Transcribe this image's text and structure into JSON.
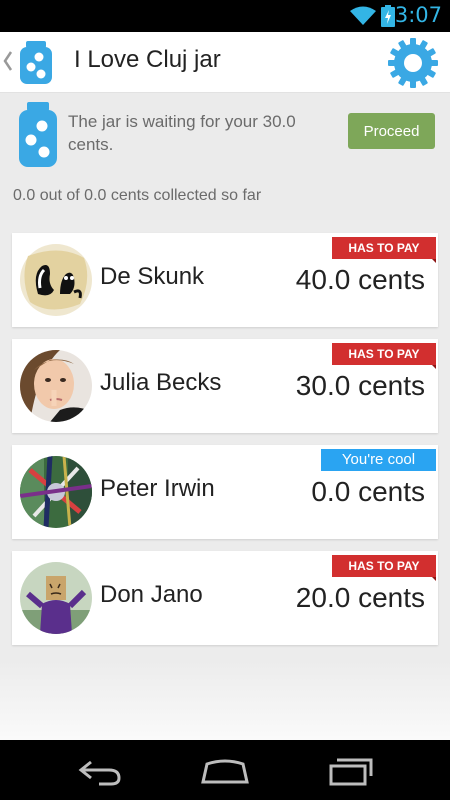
{
  "status_bar": {
    "time": "3:07",
    "wifi_icon": "wifi-icon",
    "battery_icon": "battery-charging-icon",
    "accent": "#33b5e5"
  },
  "action_bar": {
    "title": "I Love Cluj jar",
    "app_icon": "jar-icon",
    "up_icon": "chevron-left-icon",
    "settings_icon": "gear-icon",
    "accent": "#3aa8e4"
  },
  "summary": {
    "message": "The jar is waiting for your 30.0 cents.",
    "proceed_label": "Proceed",
    "collected": "0.0 out of 0.0 cents collected so far",
    "proceed_color": "#7ea759"
  },
  "members": [
    {
      "name": "De Skunk",
      "amount": "40.0 cents",
      "badge": "HAS TO PAY",
      "badge_type": "pay",
      "avatar": "skunk-avatar"
    },
    {
      "name": "Julia Becks",
      "amount": "30.0 cents",
      "badge": "HAS TO PAY",
      "badge_type": "pay",
      "avatar": "julia-avatar"
    },
    {
      "name": "Peter Irwin",
      "amount": "0.0 cents",
      "badge": "You're cool",
      "badge_type": "cool",
      "avatar": "peter-avatar"
    },
    {
      "name": "Don Jano",
      "amount": "20.0 cents",
      "badge": "HAS TO PAY",
      "badge_type": "pay",
      "avatar": "don-avatar"
    }
  ],
  "colors": {
    "has_to_pay": "#d22f2f",
    "youre_cool": "#2aa4f2"
  },
  "nav": {
    "back_icon": "back-icon",
    "home_icon": "home-icon",
    "recents_icon": "recents-icon"
  }
}
